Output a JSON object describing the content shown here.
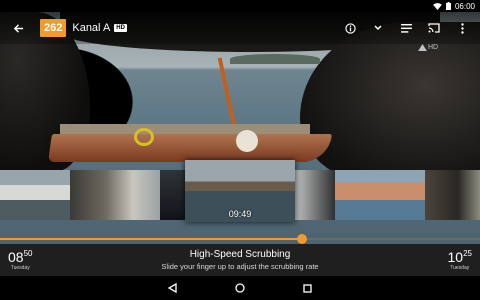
{
  "status_bar": {
    "time": "06:00"
  },
  "top_bar": {
    "channel_number": "262",
    "channel_name": "Kanal A",
    "hd_badge": "HD"
  },
  "video": {
    "channel_logo_text": "HD"
  },
  "scrubber": {
    "thumb_time": "09:49",
    "progress_fraction": 0.63,
    "start_time_hours": "08",
    "start_time_minutes": "50",
    "start_day": "Tuesday",
    "end_time_hours": "10",
    "end_time_minutes": "25",
    "end_day": "Tuesday",
    "title": "High-Speed Scrubbing",
    "hint": "Slide your finger up to adjust the scrubbing rate"
  },
  "colors": {
    "accent": "#f29b2a"
  },
  "icons": [
    "wifi-icon",
    "battery-icon",
    "back-arrow-icon",
    "info-icon",
    "chevron-down-icon",
    "list-icon",
    "cast-icon",
    "more-vert-icon",
    "nav-back-icon",
    "nav-home-icon",
    "nav-recents-icon"
  ]
}
